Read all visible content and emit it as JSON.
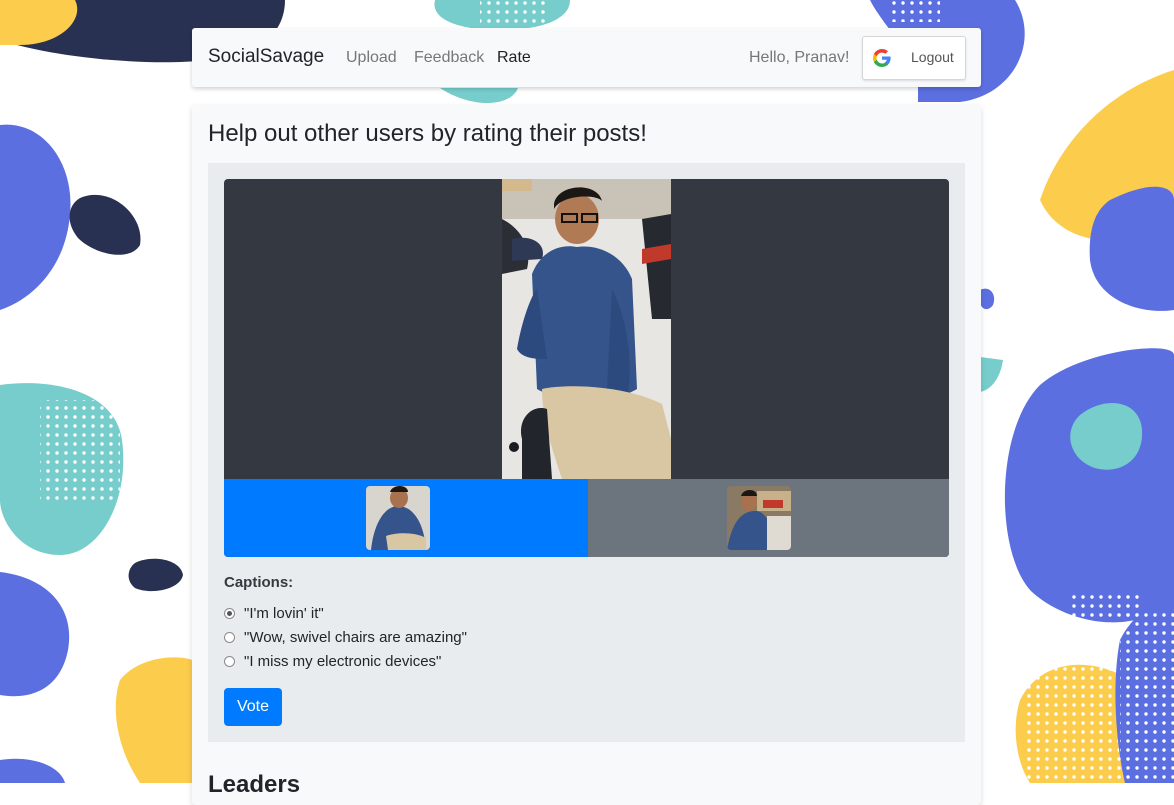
{
  "navbar": {
    "brand": "SocialSavage",
    "links": [
      {
        "label": "Upload",
        "active": false
      },
      {
        "label": "Feedback",
        "active": false
      },
      {
        "label": "Rate",
        "active": true
      }
    ],
    "greeting": "Hello, Pranav!",
    "logout_label": "Logout",
    "logout_icon": "google-g-icon"
  },
  "main": {
    "title": "Help out other users by rating their posts!",
    "carousel": {
      "slides": [
        {
          "description": "seated-person-photo",
          "selected": true
        },
        {
          "description": "seated-person-photo-alt",
          "selected": false
        }
      ]
    },
    "captions_label": "Captions:",
    "captions": [
      {
        "text": "\"I'm lovin' it\"",
        "checked": true
      },
      {
        "text": "\"Wow, swivel chairs are amazing\"",
        "checked": false
      },
      {
        "text": "\"I miss my electronic devices\"",
        "checked": false
      }
    ],
    "vote_label": "Vote",
    "next_section_title": "Leaders"
  },
  "colors": {
    "primary": "#007bff",
    "secondary": "#6c757d",
    "viewer_bg": "#333841",
    "blob_blue": "#5b6fe0",
    "blob_teal": "#76cdcb",
    "blob_yellow": "#fccc4c",
    "blob_navy": "#283151"
  }
}
